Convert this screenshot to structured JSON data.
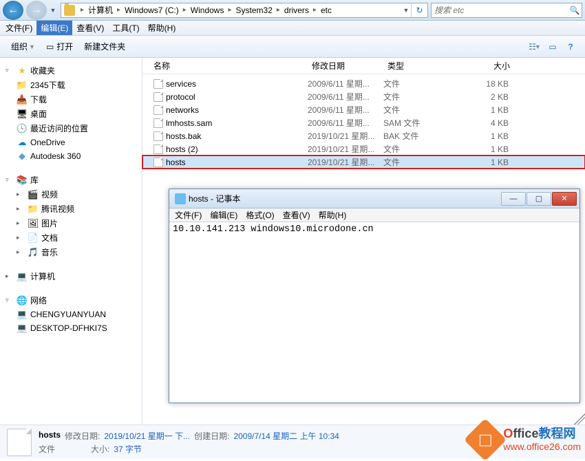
{
  "nav": {
    "breadcrumb": [
      "计算机",
      "Windows7 (C:)",
      "Windows",
      "System32",
      "drivers",
      "etc"
    ],
    "search_placeholder": "搜索 etc"
  },
  "menu": {
    "file": "文件(F)",
    "edit": "编辑(E)",
    "view": "查看(V)",
    "tools": "工具(T)",
    "help": "帮助(H)"
  },
  "toolbar": {
    "organize": "组织",
    "open": "打开",
    "new_folder": "新建文件夹"
  },
  "sidebar": {
    "favorites": "收藏夹",
    "fav_items": [
      "2345下载",
      "下载",
      "桌面",
      "最近访问的位置",
      "OneDrive",
      "Autodesk 360"
    ],
    "libraries": "库",
    "lib_items": [
      "视频",
      "腾讯视频",
      "图片",
      "文档",
      "音乐"
    ],
    "computer": "计算机",
    "network": "网络",
    "net_items": [
      "CHENGYUANYUAN",
      "DESKTOP-DFHKI7S"
    ]
  },
  "columns": {
    "name": "名称",
    "date": "修改日期",
    "type": "类型",
    "size": "大小"
  },
  "files": [
    {
      "name": "services",
      "date": "2009/6/11 星期...",
      "type": "文件",
      "size": "18 KB"
    },
    {
      "name": "protocol",
      "date": "2009/6/11 星期...",
      "type": "文件",
      "size": "2 KB"
    },
    {
      "name": "networks",
      "date": "2009/6/11 星期...",
      "type": "文件",
      "size": "1 KB"
    },
    {
      "name": "lmhosts.sam",
      "date": "2009/6/11 星期...",
      "type": "SAM 文件",
      "size": "4 KB"
    },
    {
      "name": "hosts.bak",
      "date": "2019/10/21 星期...",
      "type": "BAK 文件",
      "size": "1 KB"
    },
    {
      "name": "hosts (2)",
      "date": "2019/10/21 星期...",
      "type": "文件",
      "size": "1 KB"
    },
    {
      "name": "hosts",
      "date": "2019/10/21 星期...",
      "type": "文件",
      "size": "1 KB"
    }
  ],
  "details": {
    "name": "hosts",
    "mdate_label": "修改日期:",
    "mdate": "2019/10/21 星期一 下...",
    "cdate_label": "创建日期:",
    "cdate": "2009/7/14 星期二 上午 10:34",
    "type": "文件",
    "size_label": "大小:",
    "size": "37 字节"
  },
  "notepad": {
    "title": "hosts - 记事本",
    "menu": {
      "file": "文件(F)",
      "edit": "编辑(E)",
      "format": "格式(O)",
      "view": "查看(V)",
      "help": "帮助(H)"
    },
    "content": "10.10.141.213 windows10.microdone.cn"
  },
  "watermark": {
    "brand_part1": "O",
    "brand_part2": "ffice",
    "brand_part3": "教程网",
    "url": "www.office26.com"
  }
}
